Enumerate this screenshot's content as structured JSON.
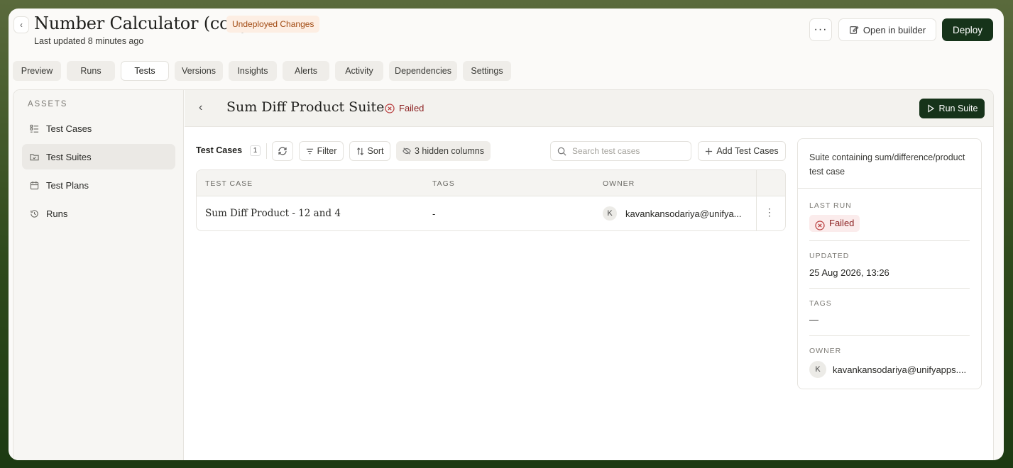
{
  "header": {
    "title": "Number Calculator (copy)",
    "badge": "Undeployed Changes",
    "last_updated": "Last updated 8 minutes ago",
    "more_label": "···",
    "open_builder_label": "Open in builder",
    "deploy_label": "Deploy"
  },
  "tabs": [
    {
      "label": "Preview"
    },
    {
      "label": "Runs"
    },
    {
      "label": "Tests",
      "active": true
    },
    {
      "label": "Versions"
    },
    {
      "label": "Insights"
    },
    {
      "label": "Alerts"
    },
    {
      "label": "Activity"
    },
    {
      "label": "Dependencies"
    },
    {
      "label": "Settings"
    }
  ],
  "sidebar": {
    "section_label": "ASSETS",
    "items": [
      {
        "label": "Test Cases",
        "icon": "list-check-icon"
      },
      {
        "label": "Test Suites",
        "icon": "folder-check-icon",
        "active": true
      },
      {
        "label": "Test Plans",
        "icon": "calendar-icon"
      },
      {
        "label": "Runs",
        "icon": "history-icon"
      }
    ]
  },
  "suite": {
    "title": "Sum Diff Product Suite",
    "status": "Failed",
    "run_label": "Run Suite"
  },
  "toolbar": {
    "label": "Test Cases",
    "count": "1",
    "filter_label": "Filter",
    "sort_label": "Sort",
    "hidden_columns_label": "3 hidden columns",
    "search_placeholder": "Search test cases",
    "add_label": "Add Test Cases"
  },
  "table": {
    "columns": [
      "TEST CASE",
      "TAGS",
      "OWNER"
    ],
    "rows": [
      {
        "name": "Sum Diff Product - 12 and 4",
        "tags": "-",
        "owner_initial": "K",
        "owner": "kavankansodariya@unifya..."
      }
    ]
  },
  "details": {
    "description": "Suite containing sum/difference/product test case",
    "last_run_label": "LAST RUN",
    "last_run_status": "Failed",
    "updated_label": "UPDATED",
    "updated_value": "25 Aug 2026, 13:26",
    "tags_label": "TAGS",
    "tags_value": "—",
    "owner_label": "OWNER",
    "owner_initial": "K",
    "owner_value": "kavankansodariya@unifyapps...."
  },
  "colors": {
    "accent": "#16331a",
    "failed": "#8a1e1e",
    "badge_bg": "#fdeee3"
  }
}
